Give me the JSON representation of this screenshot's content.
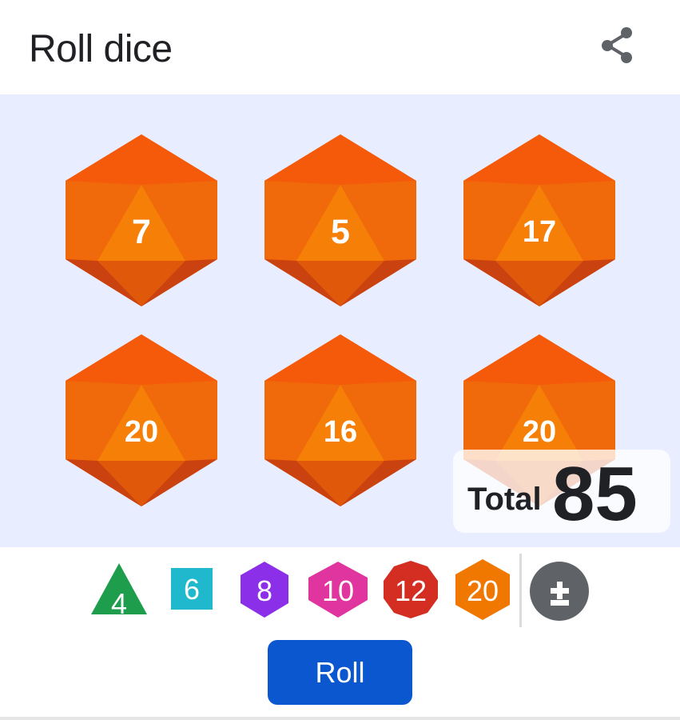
{
  "header": {
    "title": "Roll dice",
    "share_icon": "share-icon"
  },
  "dice": [
    {
      "sides": 20,
      "value": "7"
    },
    {
      "sides": 20,
      "value": "5"
    },
    {
      "sides": 20,
      "value": "17"
    },
    {
      "sides": 20,
      "value": "20"
    },
    {
      "sides": 20,
      "value": "16"
    },
    {
      "sides": 20,
      "value": "20"
    }
  ],
  "total": {
    "label": "Total",
    "value": "85"
  },
  "die_types": [
    {
      "label": "4",
      "shape": "triangle",
      "color": "#1e9e4c"
    },
    {
      "label": "6",
      "shape": "square",
      "color": "#1fb8cd"
    },
    {
      "label": "8",
      "shape": "hexagon",
      "color": "#8b2fe8"
    },
    {
      "label": "10",
      "shape": "hexagon-wide",
      "color": "#e0359e"
    },
    {
      "label": "12",
      "shape": "decagon",
      "color": "#d42d22"
    },
    {
      "label": "20",
      "shape": "hexagon-tall",
      "color": "#f07800"
    }
  ],
  "add_die_icon": "plus-minus-icon",
  "roll_label": "Roll",
  "colors": {
    "die_face": "#f46d0d",
    "stage_bg": "#e8edff",
    "roll_button": "#0b57d0",
    "add_button": "#5f6368"
  }
}
